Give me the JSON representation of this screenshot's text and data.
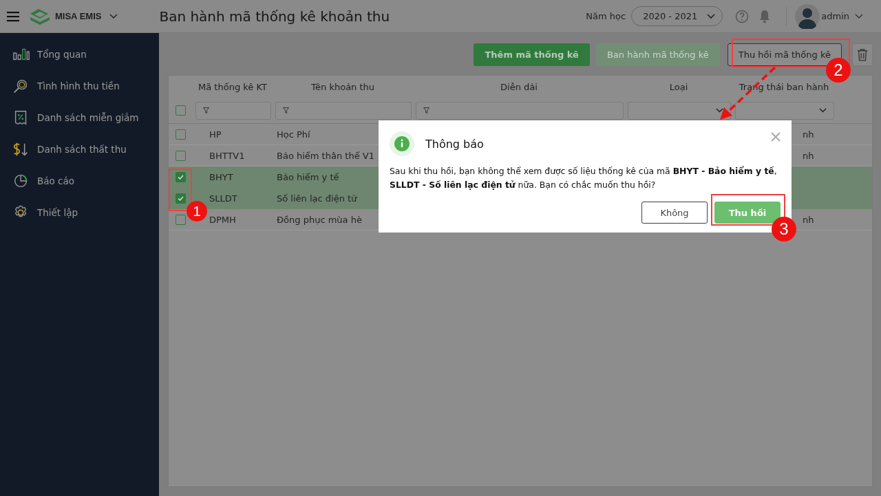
{
  "header": {
    "brand": "MISA EMIS",
    "title": "Ban hành mã thống kê khoản thu",
    "year_label": "Năm học",
    "year_value": "2020 - 2021",
    "user": "admin"
  },
  "sidebar": {
    "items": [
      {
        "label": "Tổng quan"
      },
      {
        "label": "Tình hình thu tiền"
      },
      {
        "label": "Danh sách miễn giảm"
      },
      {
        "label": "Danh sách thất thu"
      },
      {
        "label": "Báo cáo"
      },
      {
        "label": "Thiết lập"
      }
    ]
  },
  "toolbar": {
    "buttons": [
      {
        "label": "Thêm mã thống kê",
        "kind": "primary",
        "disabled": false
      },
      {
        "label": "Ban hành mã thống kê",
        "kind": "primary",
        "disabled": true
      },
      {
        "label": "Thu hồi mã thống kê",
        "kind": "outline",
        "disabled": false
      }
    ]
  },
  "table": {
    "all_checked": false,
    "columns": [
      {
        "label": "Mã thống kê KT",
        "kind": "text"
      },
      {
        "label": "Tên khoản thu",
        "kind": "text"
      },
      {
        "label": "Diễn dải",
        "kind": "text"
      },
      {
        "label": "Loại",
        "kind": "select"
      },
      {
        "label": "Trạng thái ban hành",
        "kind": "select"
      }
    ],
    "rows": [
      {
        "code": "HP",
        "name": "Học Phí",
        "status": "nh",
        "checked": false
      },
      {
        "code": "BHTTV1",
        "name": "Bảo hiểm thân thể V1",
        "status": "nh",
        "checked": false
      },
      {
        "code": "BHYT",
        "name": "Bảo hiểm y tế",
        "checked": true
      },
      {
        "code": "SLLDT",
        "name": "Số liên lạc điện tử",
        "checked": true
      },
      {
        "code": "DPMH",
        "name": "Đồng phục mùa hè",
        "status": "nh",
        "checked": false
      }
    ]
  },
  "dialog": {
    "title": "Thông báo",
    "message": "Sau khi thu hồi, bạn không thể xem được số liệu thống kê của mã **BHYT - Bảo hiểm y tế**, **SLLDT - Số liên lạc điện tử** nữa. Bạn có chắc muốn thu hồi?",
    "buttons": [
      {
        "label": "Không",
        "kind": "secondary"
      },
      {
        "label": "Thu hồi",
        "kind": "primary"
      }
    ]
  },
  "annotations": {
    "badges": [
      "1",
      "2",
      "3"
    ]
  }
}
